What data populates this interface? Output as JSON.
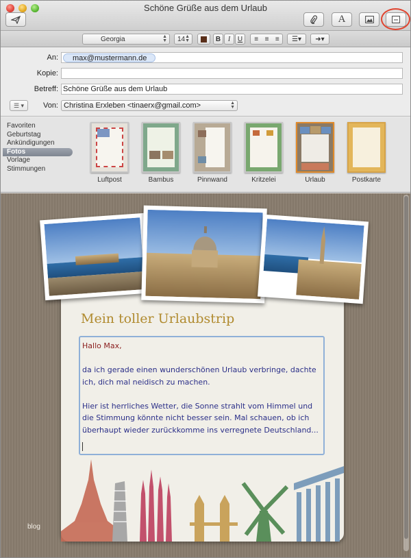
{
  "window": {
    "title": "Schöne Grüße aus dem Urlaub"
  },
  "toolbar": {
    "send_icon": "paper-plane-icon",
    "attach_icon": "paperclip-icon",
    "fonts_glyph": "A",
    "photo_icon": "photo-browser-icon",
    "stationery_icon": "stationery-icon",
    "highlight_color": "#e0442f"
  },
  "format_bar": {
    "font_name": "Georgia",
    "font_size": "14",
    "bold": "B",
    "italic": "I",
    "underline": "U",
    "text_color": "#5a2f1a"
  },
  "headers": {
    "to_label": "An:",
    "to_value": "max@mustermann.de",
    "cc_label": "Kopie:",
    "cc_value": "",
    "subject_label": "Betreff:",
    "subject_value": "Schöne Grüße aus dem Urlaub",
    "from_label": "Von:",
    "from_value": "Christina Erxleben <tinaerx@gmail.com>"
  },
  "stationery": {
    "categories": [
      {
        "label": "Favoriten"
      },
      {
        "label": "Geburtstag"
      },
      {
        "label": "Ankündigungen"
      },
      {
        "label": "Fotos"
      },
      {
        "label": "Vorlage"
      },
      {
        "label": "Stimmungen"
      }
    ],
    "selected_category": "Fotos",
    "templates": [
      {
        "label": "Luftpost"
      },
      {
        "label": "Bambus"
      },
      {
        "label": "Pinnwand"
      },
      {
        "label": "Kritzelei"
      },
      {
        "label": "Urlaub"
      },
      {
        "label": "Postkarte"
      }
    ],
    "selected_template": "Urlaub"
  },
  "message": {
    "heading": "Mein toller Urlaubstrip",
    "greeting": "Hallo Max,",
    "paragraph1": "da ich gerade einen wunderschönen Urlaub verbringe, dachte ich, dich mal neidisch zu machen.",
    "paragraph2": "Hier ist herrliches Wetter, die Sonne strahlt vom Himmel und die Stimmung könnte nicht besser sein. Mal schauen, ob ich überhaupt wieder zurückkomme ins verregnete Deutschland..."
  },
  "watermark": "blog"
}
